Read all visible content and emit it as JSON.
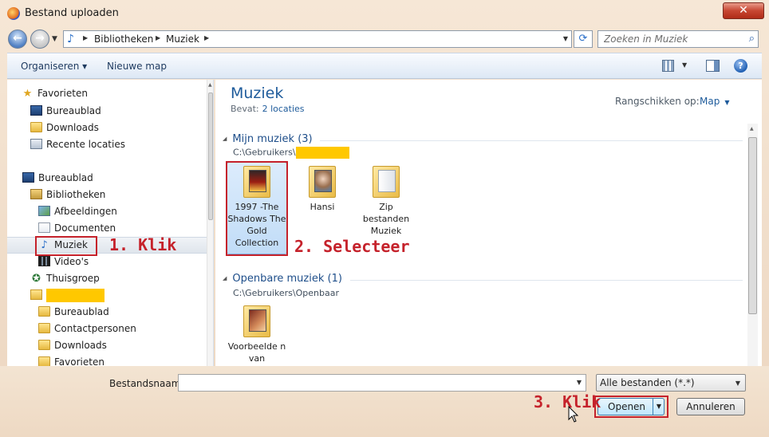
{
  "window": {
    "title": "Bestand uploaden",
    "close_glyph": "✕"
  },
  "navigation": {
    "back_glyph": "←",
    "forward_glyph": "→",
    "history_dropdown_glyph": "▼",
    "address": {
      "icon": "music-library-icon",
      "breadcrumbs": [
        "Bibliotheken",
        "Muziek"
      ],
      "arrow_glyph": "▶",
      "dropdown_glyph": "▼"
    },
    "refresh_glyph": "⟳",
    "search": {
      "placeholder": "Zoeken in Muziek",
      "icon": "search-icon",
      "glyph": "⌕"
    }
  },
  "toolbar": {
    "organize_label": "Organiseren ▾",
    "new_folder_label": "Nieuwe map",
    "views_dropdown_glyph": "▼",
    "help_glyph": "?"
  },
  "nav_pane": {
    "items": [
      {
        "label": "Favorieten",
        "icon": "star-icon"
      },
      {
        "label": "Bureaublad",
        "icon": "desktop-icon"
      },
      {
        "label": "Downloads",
        "icon": "folder-icon"
      },
      {
        "label": "Recente locaties",
        "icon": "recent-places-icon"
      },
      {
        "label": "Bureaublad",
        "icon": "desktop-icon"
      },
      {
        "label": "Bibliotheken",
        "icon": "library-icon"
      },
      {
        "label": "Afbeeldingen",
        "icon": "pictures-icon"
      },
      {
        "label": "Documenten",
        "icon": "documents-icon"
      },
      {
        "label": "Muziek",
        "icon": "music-icon",
        "selected": true
      },
      {
        "label": "Video's",
        "icon": "video-icon"
      },
      {
        "label": "Thuisgroep",
        "icon": "homegroup-icon"
      },
      {
        "label": "",
        "icon": "user-folder-icon",
        "redacted": true
      },
      {
        "label": "Bureaublad",
        "icon": "folder-icon"
      },
      {
        "label": "Contactpersonen",
        "icon": "folder-icon"
      },
      {
        "label": "Downloads",
        "icon": "folder-icon"
      },
      {
        "label": "Favorieten",
        "icon": "folder-icon"
      }
    ]
  },
  "content": {
    "library_title": "Muziek",
    "includes_label": "Bevat:",
    "includes_value": "2 locaties",
    "arrange_label": "Rangschikken op:",
    "arrange_value": "Map",
    "arrange_chevron": "▼",
    "groups": [
      {
        "header": "Mijn muziek (3)",
        "path": "C:\\Gebruikers\\",
        "items": [
          {
            "label": "1997 -The Shadows The Gold Collection",
            "icon": "album-folder-icon",
            "selected": true
          },
          {
            "label": "Hansi",
            "icon": "album-folder-icon"
          },
          {
            "label": "Zip bestanden Muziek",
            "icon": "folder-icon"
          }
        ]
      },
      {
        "header": "Openbare muziek (1)",
        "path": "C:\\Gebruikers\\Openbaar",
        "items": [
          {
            "label": "Voorbeelde n van",
            "icon": "album-folder-icon"
          }
        ]
      }
    ],
    "group_chevron": "◢"
  },
  "footer": {
    "filename_label": "Bestandsnaam:",
    "filename_value": "",
    "filename_dropdown_glyph": "▼",
    "filetype_value": "Alle bestanden (*.*)",
    "filetype_arrow": "▼",
    "open_label": "Openen",
    "open_split_glyph": "▼",
    "cancel_label": "Annuleren"
  },
  "annotations": {
    "step1": "1. Klik",
    "step2": "2. Selecteer",
    "step3": "3. Klik",
    "color": "#c5222b"
  }
}
